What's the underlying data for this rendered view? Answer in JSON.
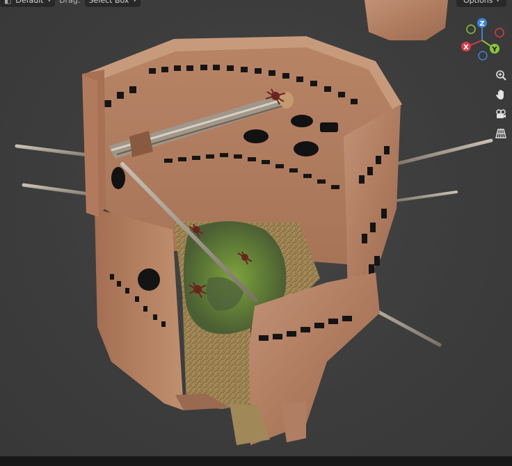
{
  "header": {
    "mode_dropdown": {
      "value": "Default"
    },
    "drag_label": "Drag:",
    "drag_dropdown": {
      "value": "Select Box"
    },
    "options_button": "Options"
  },
  "gizmo": {
    "axes": [
      "Z",
      "X",
      "Y"
    ],
    "colors": {
      "x": "#d63c4c",
      "y": "#8ac43c",
      "z": "#3c82d6"
    }
  },
  "nav_buttons": [
    "zoom-icon",
    "hand-pan-icon",
    "camera-view-icon",
    "grid-perspective-icon"
  ],
  "scene": {
    "object": "textured stone tower model with barbed poles and moss floor",
    "colors": {
      "stone": "#b88264",
      "stone_dark": "#8a5a44",
      "moss": "#6b8a32",
      "straw": "#9c8454",
      "pole": "#8a8478"
    }
  }
}
